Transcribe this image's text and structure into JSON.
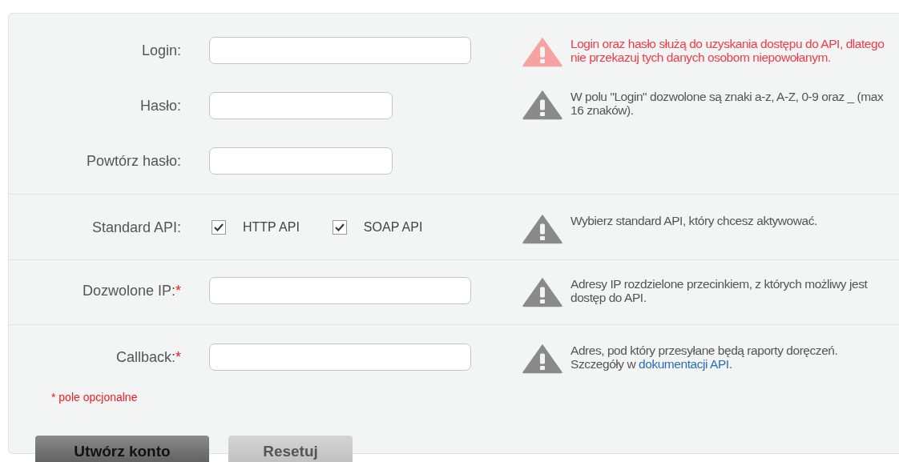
{
  "sections": [
    {
      "kind": "fields",
      "rows": [
        {
          "label": "Login:",
          "wide": true
        },
        {
          "label": "Hasło:",
          "wide": false
        },
        {
          "label": "Powtórz hasło:",
          "wide": false
        }
      ],
      "hints": [
        {
          "kind": "alert",
          "text": "Login oraz hasło służą do uzyskania dostępu do API, dlatego nie przekazuj tych danych osobom niepowołanym."
        },
        {
          "kind": "info",
          "text": "W polu \"Login\" dozwolone są znaki a-z, A-Z, 0-9 oraz _ (max 16 znaków)."
        }
      ]
    },
    {
      "kind": "checkboxes",
      "label": "Standard API:",
      "options": [
        {
          "label": "HTTP API",
          "checked": true
        },
        {
          "label": "SOAP API",
          "checked": true
        }
      ],
      "hints": [
        {
          "kind": "info",
          "text": "Wybierz standard API, który chcesz aktywować."
        }
      ]
    },
    {
      "kind": "fields",
      "rows": [
        {
          "label": "Dozwolone IP:",
          "marker": "*",
          "wide": true
        }
      ],
      "hints": [
        {
          "kind": "info",
          "text": "Adresy IP rozdzielone przecinkiem, z których możliwy jest dostęp do API."
        }
      ]
    },
    {
      "kind": "fields",
      "rows": [
        {
          "label": "Callback:",
          "marker": "*",
          "wide": true
        }
      ],
      "note": "* pole opcjonalne",
      "hints": [
        {
          "kind": "info",
          "text": "Adres, pod który przesyłane będą raporty doręczeń. Szczegóły w",
          "link": "dokumentacji API",
          "after": "."
        }
      ]
    }
  ],
  "buttons": [
    {
      "label": "Utwórz konto",
      "kind": "primary"
    },
    {
      "label": "Resetuj",
      "kind": "secondary"
    }
  ]
}
